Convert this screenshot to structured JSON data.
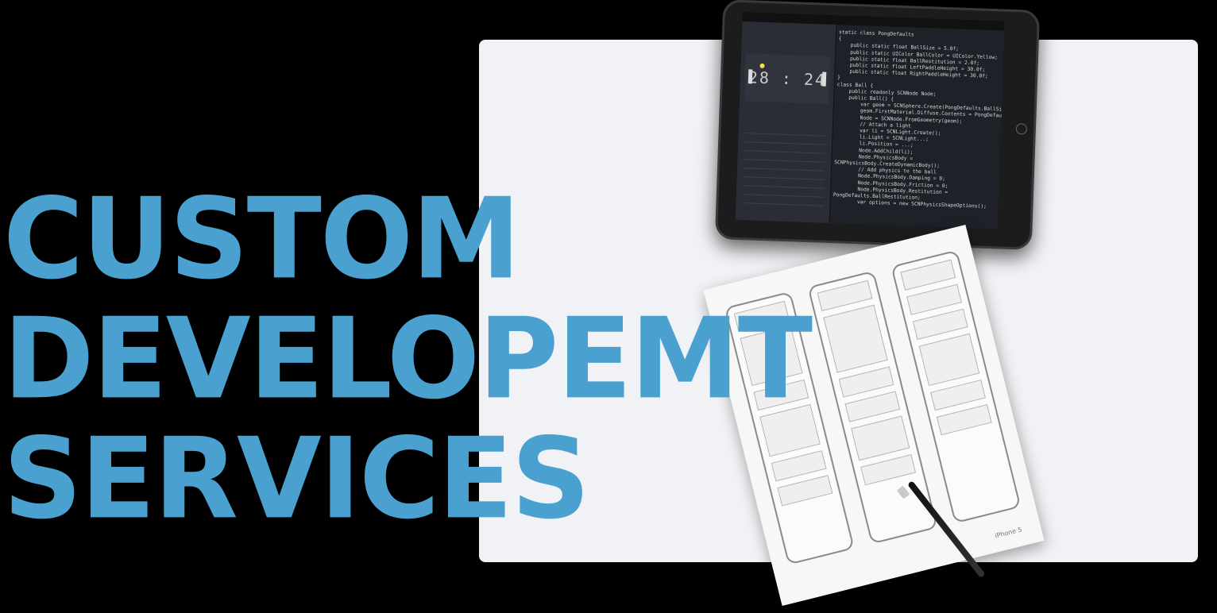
{
  "headline": {
    "line1": "CUSTOM",
    "line2": "DEVELOPEMT",
    "line3": "SERVICES",
    "color": "#4aa1d0"
  },
  "tablet": {
    "game_timer": "28 : 24",
    "code_lines": [
      "static class PongDefaults",
      "{",
      "    public static float BallSize = 5.0f;",
      "    public static UIColor BallColor = UIColor.Yellow;",
      "    public static float BallRestitution = 2.0f;",
      "    public static float LeftPaddleHeight = 30.0f;",
      "    public static float RightPaddleHeight = 30.0f;",
      "}",
      "",
      "class Ball {",
      "    public readonly SCNNode Node;",
      "    public Ball() {",
      "        var geom = SCNSphere.Create(PongDefaults.BallSize);",
      "        geom.FirstMaterial.Diffuse.Contents = PongDefaults.BallColor;",
      "        Node = SCNNode.FromGeometry(geom);",
      "",
      "        // Attach a light",
      "        var li = SCNLight.Create();",
      "        li.Light = SCNLight...;",
      "        li.Position = ...;",
      "        Node.AddChild(li);",
      "        Node.PhysicsBody =",
      "SCNPhysicsBody.CreateDynamicBody();",
      "",
      "        // Add physics to the ball",
      "        Node.PhysicsBody.Damping = 0;",
      "        Node.PhysicsBody.Friction = 0;",
      "        Node.PhysicsBody.Restitution =",
      "PongDefaults.BallRestitution;",
      "        var options = new SCNPhysicsShapeOptions();"
    ]
  },
  "paper": {
    "label": "iPhone 5"
  }
}
